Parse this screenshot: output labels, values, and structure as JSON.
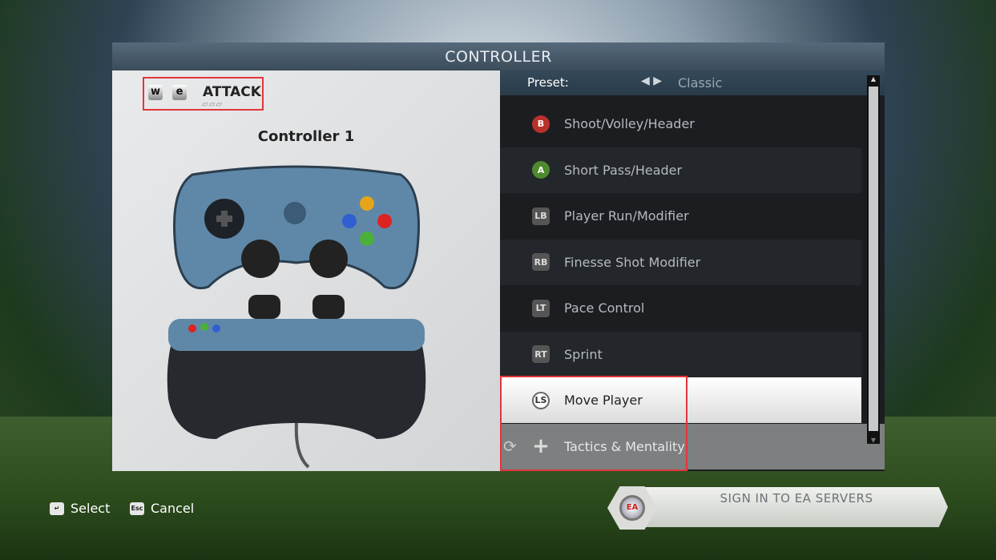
{
  "header": {
    "title": "CONTROLLER"
  },
  "mode": {
    "key_prev": "w",
    "key_next": "e",
    "label": "ATTACK",
    "page_dots": 3
  },
  "controller": {
    "name": "Controller 1"
  },
  "preset": {
    "label": "Preset:",
    "value": "Classic"
  },
  "actions": [
    {
      "button": "B",
      "label": "Shoot/Volley/Header",
      "color": "#b8322c"
    },
    {
      "button": "A",
      "label": "Short Pass/Header",
      "color": "#4e8a2e"
    },
    {
      "button": "LB",
      "label": "Player Run/Modifier",
      "color": "#666"
    },
    {
      "button": "RB",
      "label": "Finesse Shot Modifier",
      "color": "#666"
    },
    {
      "button": "LT",
      "label": "Pace Control",
      "color": "#666"
    },
    {
      "button": "RT",
      "label": "Sprint",
      "color": "#666"
    },
    {
      "button": "LS",
      "label": "Move Player",
      "color": "#e0e0e0"
    },
    {
      "button": "+",
      "label": "Tactics & Mentality",
      "color": "#ccc"
    }
  ],
  "selected_index": 6,
  "footer": {
    "select_label": "Select",
    "select_key": "↵",
    "cancel_label": "Cancel",
    "cancel_key": "Esc"
  },
  "sign_in": {
    "label": "SIGN IN TO EA SERVERS",
    "logo": "EA"
  }
}
